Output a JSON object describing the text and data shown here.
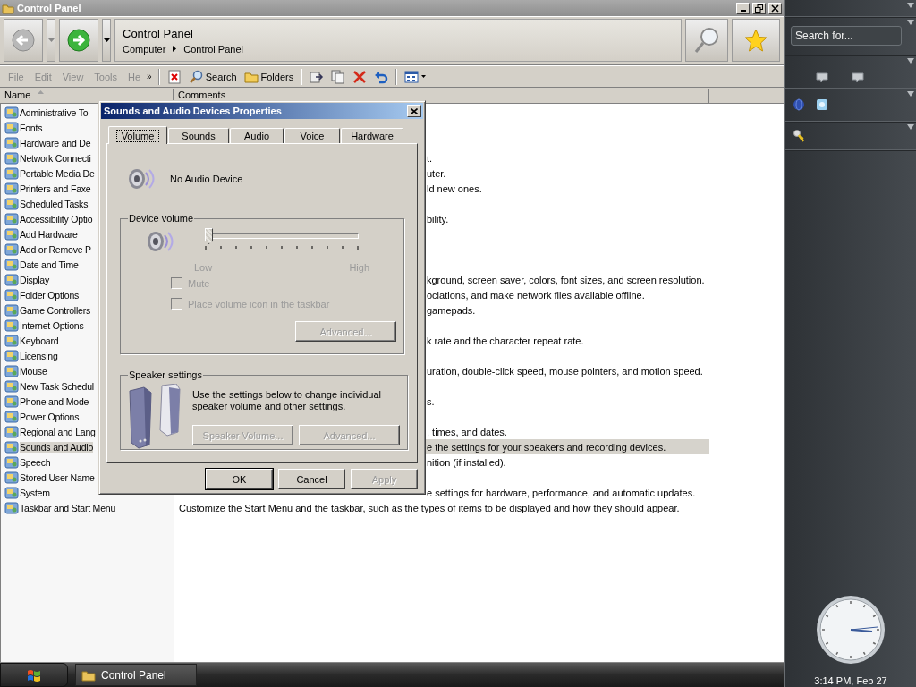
{
  "window": {
    "title": "Control Panel"
  },
  "address": {
    "title": "Control Panel",
    "breadcrumb": [
      "Computer",
      "Control Panel"
    ]
  },
  "menu": [
    "File",
    "Edit",
    "View",
    "Tools",
    "He"
  ],
  "menu_more": "»",
  "toolbar": [
    {
      "kind": "delete-doc"
    },
    {
      "kind": "search",
      "label": "Search"
    },
    {
      "kind": "folders",
      "label": "Folders"
    },
    {
      "kind": "move"
    },
    {
      "kind": "copy"
    },
    {
      "kind": "delete"
    },
    {
      "kind": "undo"
    },
    {
      "kind": "views"
    }
  ],
  "columns": [
    {
      "label": "Name",
      "sorted": true
    },
    {
      "label": "Comments",
      "sorted": false
    }
  ],
  "rows": [
    {
      "name": "Administrative To",
      "selected": false
    },
    {
      "name": "Fonts",
      "selected": false
    },
    {
      "name": "Hardware and De",
      "selected": false
    },
    {
      "name": "Network Connecti",
      "comment": "t.",
      "selected": false
    },
    {
      "name": "Portable Media De",
      "comment": "uter.",
      "selected": false
    },
    {
      "name": "Printers and Faxe",
      "comment": "ld new ones.",
      "selected": false
    },
    {
      "name": "Scheduled Tasks",
      "selected": false
    },
    {
      "name": "Accessibility Optio",
      "comment": "bility.",
      "selected": false
    },
    {
      "name": "Add Hardware",
      "selected": false
    },
    {
      "name": "Add or Remove P",
      "selected": false
    },
    {
      "name": "Date and Time",
      "selected": false
    },
    {
      "name": "Display",
      "comment": "kground, screen saver, colors, font sizes, and screen resolution.",
      "selected": false
    },
    {
      "name": "Folder Options",
      "comment": "ociations, and make network files available offline.",
      "selected": false
    },
    {
      "name": "Game Controllers",
      "comment": "gamepads.",
      "selected": false
    },
    {
      "name": "Internet Options",
      "selected": false
    },
    {
      "name": "Keyboard",
      "comment": "k rate and the character repeat rate.",
      "selected": false
    },
    {
      "name": "Licensing",
      "selected": false
    },
    {
      "name": "Mouse",
      "comment": "uration, double-click speed, mouse pointers, and motion speed.",
      "selected": false
    },
    {
      "name": "New Task Schedul",
      "selected": false
    },
    {
      "name": "Phone and Mode",
      "comment": "s.",
      "selected": false
    },
    {
      "name": "Power Options",
      "selected": false
    },
    {
      "name": "Regional and Lang",
      "comment": ", times, and dates.",
      "selected": false
    },
    {
      "name": "Sounds and Audio",
      "comment": "e the settings for your speakers and recording devices.",
      "selected": true
    },
    {
      "name": "Speech",
      "comment": "nition (if installed).",
      "selected": false
    },
    {
      "name": "Stored User Name",
      "selected": false
    },
    {
      "name": "System",
      "comment": "e settings for hardware, performance, and automatic updates.",
      "selected": false
    },
    {
      "name": "Taskbar and Start Menu",
      "comment": "Customize the Start Menu and the taskbar, such as the types of items to be displayed and how they should appear.",
      "selected": false
    }
  ],
  "dialog": {
    "title": "Sounds and Audio Devices Properties",
    "tabs": [
      {
        "label": "Volume",
        "selected": true
      },
      {
        "label": "Sounds",
        "selected": false
      },
      {
        "label": "Audio",
        "selected": false
      },
      {
        "label": "Voice",
        "selected": false
      },
      {
        "label": "Hardware",
        "selected": false
      }
    ],
    "device_name": "No Audio Device",
    "device_volume": {
      "title": "Device volume",
      "level": 0,
      "low_label": "Low",
      "high_label": "High",
      "checkboxes": [
        {
          "label": "Mute",
          "checked": false,
          "disabled": true
        },
        {
          "label": "Place volume icon in the taskbar",
          "checked": false,
          "disabled": true
        }
      ],
      "advanced": {
        "label": "Advanced...",
        "disabled": true
      }
    },
    "speaker_settings": {
      "title": "Speaker settings",
      "text": "Use the settings below to change individual speaker volume and other settings.",
      "buttons": [
        {
          "label": "Speaker Volume...",
          "disabled": true
        },
        {
          "label": "Advanced...",
          "disabled": true
        }
      ]
    },
    "buttons": [
      {
        "label": "OK",
        "disabled": false,
        "default": true
      },
      {
        "label": "Cancel",
        "disabled": false,
        "default": false
      },
      {
        "label": "Apply",
        "disabled": true,
        "default": false
      }
    ]
  },
  "sidebar": {
    "search": {
      "placeholder": "Search for..."
    },
    "clock_text": "3:14 PM, Feb 27"
  },
  "taskbar": {
    "tasks": [
      {
        "label": "Control Panel",
        "selected": false
      }
    ]
  }
}
